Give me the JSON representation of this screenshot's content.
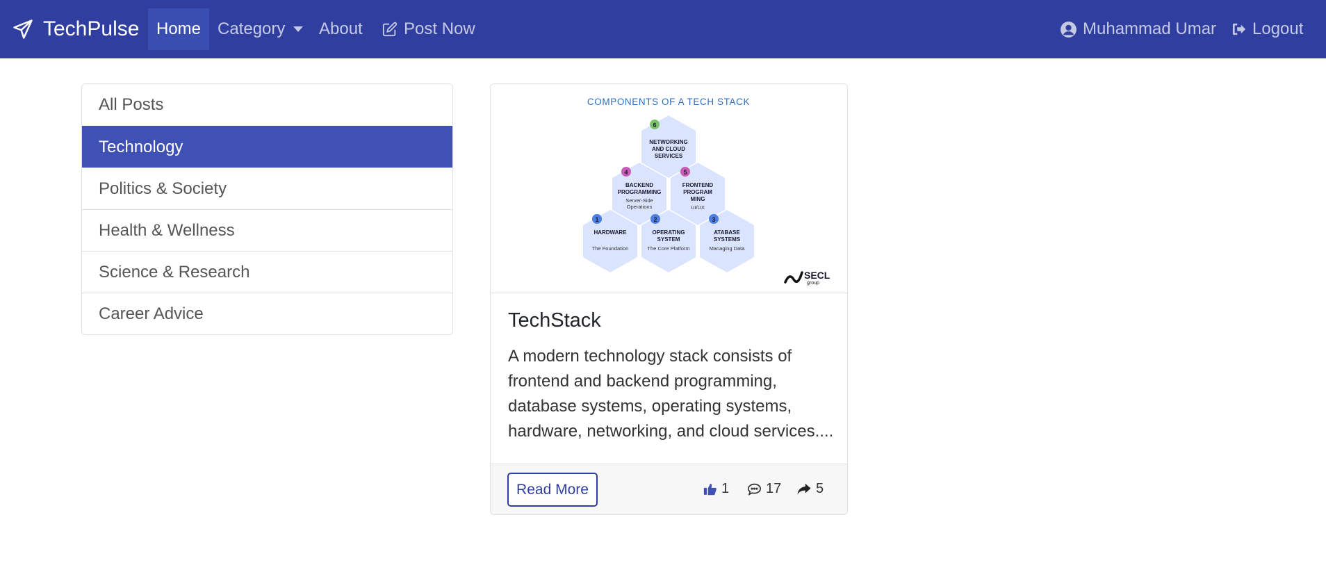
{
  "navbar": {
    "brand": "TechPulse",
    "home": "Home",
    "category": "Category",
    "about": "About",
    "post_now": "Post Now",
    "user": "Muhammad Umar",
    "logout": "Logout",
    "color": "#303f9f"
  },
  "sidebar": {
    "items": [
      {
        "label": "All Posts"
      },
      {
        "label": "Technology"
      },
      {
        "label": "Politics & Society"
      },
      {
        "label": "Health & Wellness"
      },
      {
        "label": "Science & Research"
      },
      {
        "label": "Career Advice"
      }
    ],
    "active_color": "#3f51b5"
  },
  "post": {
    "title": "TechStack",
    "excerpt": "A modern technology stack consists of frontend and backend programming, database systems, operating systems, hardware, networking, and cloud services....",
    "read_more": "Read More",
    "likes": "1",
    "comments": "17",
    "shares": "5",
    "image": {
      "heading": "COMPONENTS OF A TECH STACK",
      "brand": "SECL",
      "brand_sub": "group",
      "hexes": [
        {
          "num": "6",
          "title1": "NETWORKING",
          "title2": "AND CLOUD",
          "title3": "SERVICES",
          "sub": ""
        },
        {
          "num": "4",
          "title1": "BACKEND",
          "title2": "PROGRAMMING",
          "title3": "",
          "sub": "Server-Side Operations"
        },
        {
          "num": "5",
          "title1": "FRONTEND",
          "title2": "PROGRAM",
          "title3": "MING",
          "sub": "UI/UX"
        },
        {
          "num": "1",
          "title1": "HARDWARE",
          "title2": "",
          "title3": "",
          "sub": "The Foundation"
        },
        {
          "num": "2",
          "title1": "OPERATING",
          "title2": "SYSTEM",
          "title3": "",
          "sub": "The Core Platform"
        },
        {
          "num": "3",
          "title1": "ATABASE",
          "title2": "SYSTEMS",
          "title3": "",
          "sub": "Managing Data"
        }
      ]
    }
  }
}
